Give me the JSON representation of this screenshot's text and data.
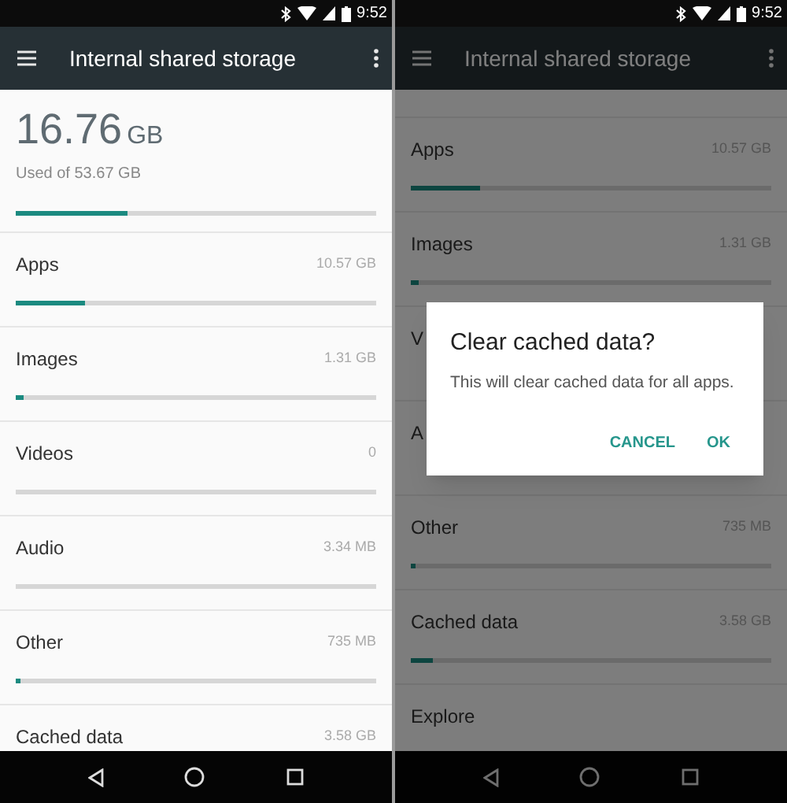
{
  "screens": [
    {
      "status_bar": {
        "time": "9:52"
      },
      "toolbar": {
        "title": "Internal shared storage"
      },
      "summary": {
        "amount": "16.76",
        "unit": "GB",
        "caption": "Used of 53.67 GB",
        "level": 0.31
      },
      "categories": [
        {
          "label": "Apps",
          "value": "10.57 GB",
          "level": 0.19
        },
        {
          "label": "Images",
          "value": "1.31 GB",
          "level": 0.02
        },
        {
          "label": "Videos",
          "value": "0",
          "level": 0
        },
        {
          "label": "Audio",
          "value": "3.34 MB",
          "level": 0
        },
        {
          "label": "Other",
          "value": "735 MB",
          "level": 0.01
        },
        {
          "label": "Cached data",
          "value": "3.58 GB"
        }
      ]
    },
    {
      "status_bar": {
        "time": "9:52"
      },
      "toolbar": {
        "title": "Internal shared storage"
      },
      "categories": [
        {
          "label": "Apps",
          "value": "10.57 GB",
          "level": 0.19
        },
        {
          "label": "Images",
          "value": "1.31 GB",
          "level": 0.02
        },
        {
          "label": "V"
        },
        {
          "label": "A"
        },
        {
          "label": "Other",
          "value": "735 MB",
          "level": 0.01
        },
        {
          "label": "Cached data",
          "value": "3.58 GB",
          "level": 0.06
        },
        {
          "label": "Explore"
        }
      ],
      "dialog": {
        "title": "Clear cached data?",
        "message": "This will clear cached data for all apps.",
        "buttons": [
          "CANCEL",
          "OK"
        ]
      }
    }
  ]
}
